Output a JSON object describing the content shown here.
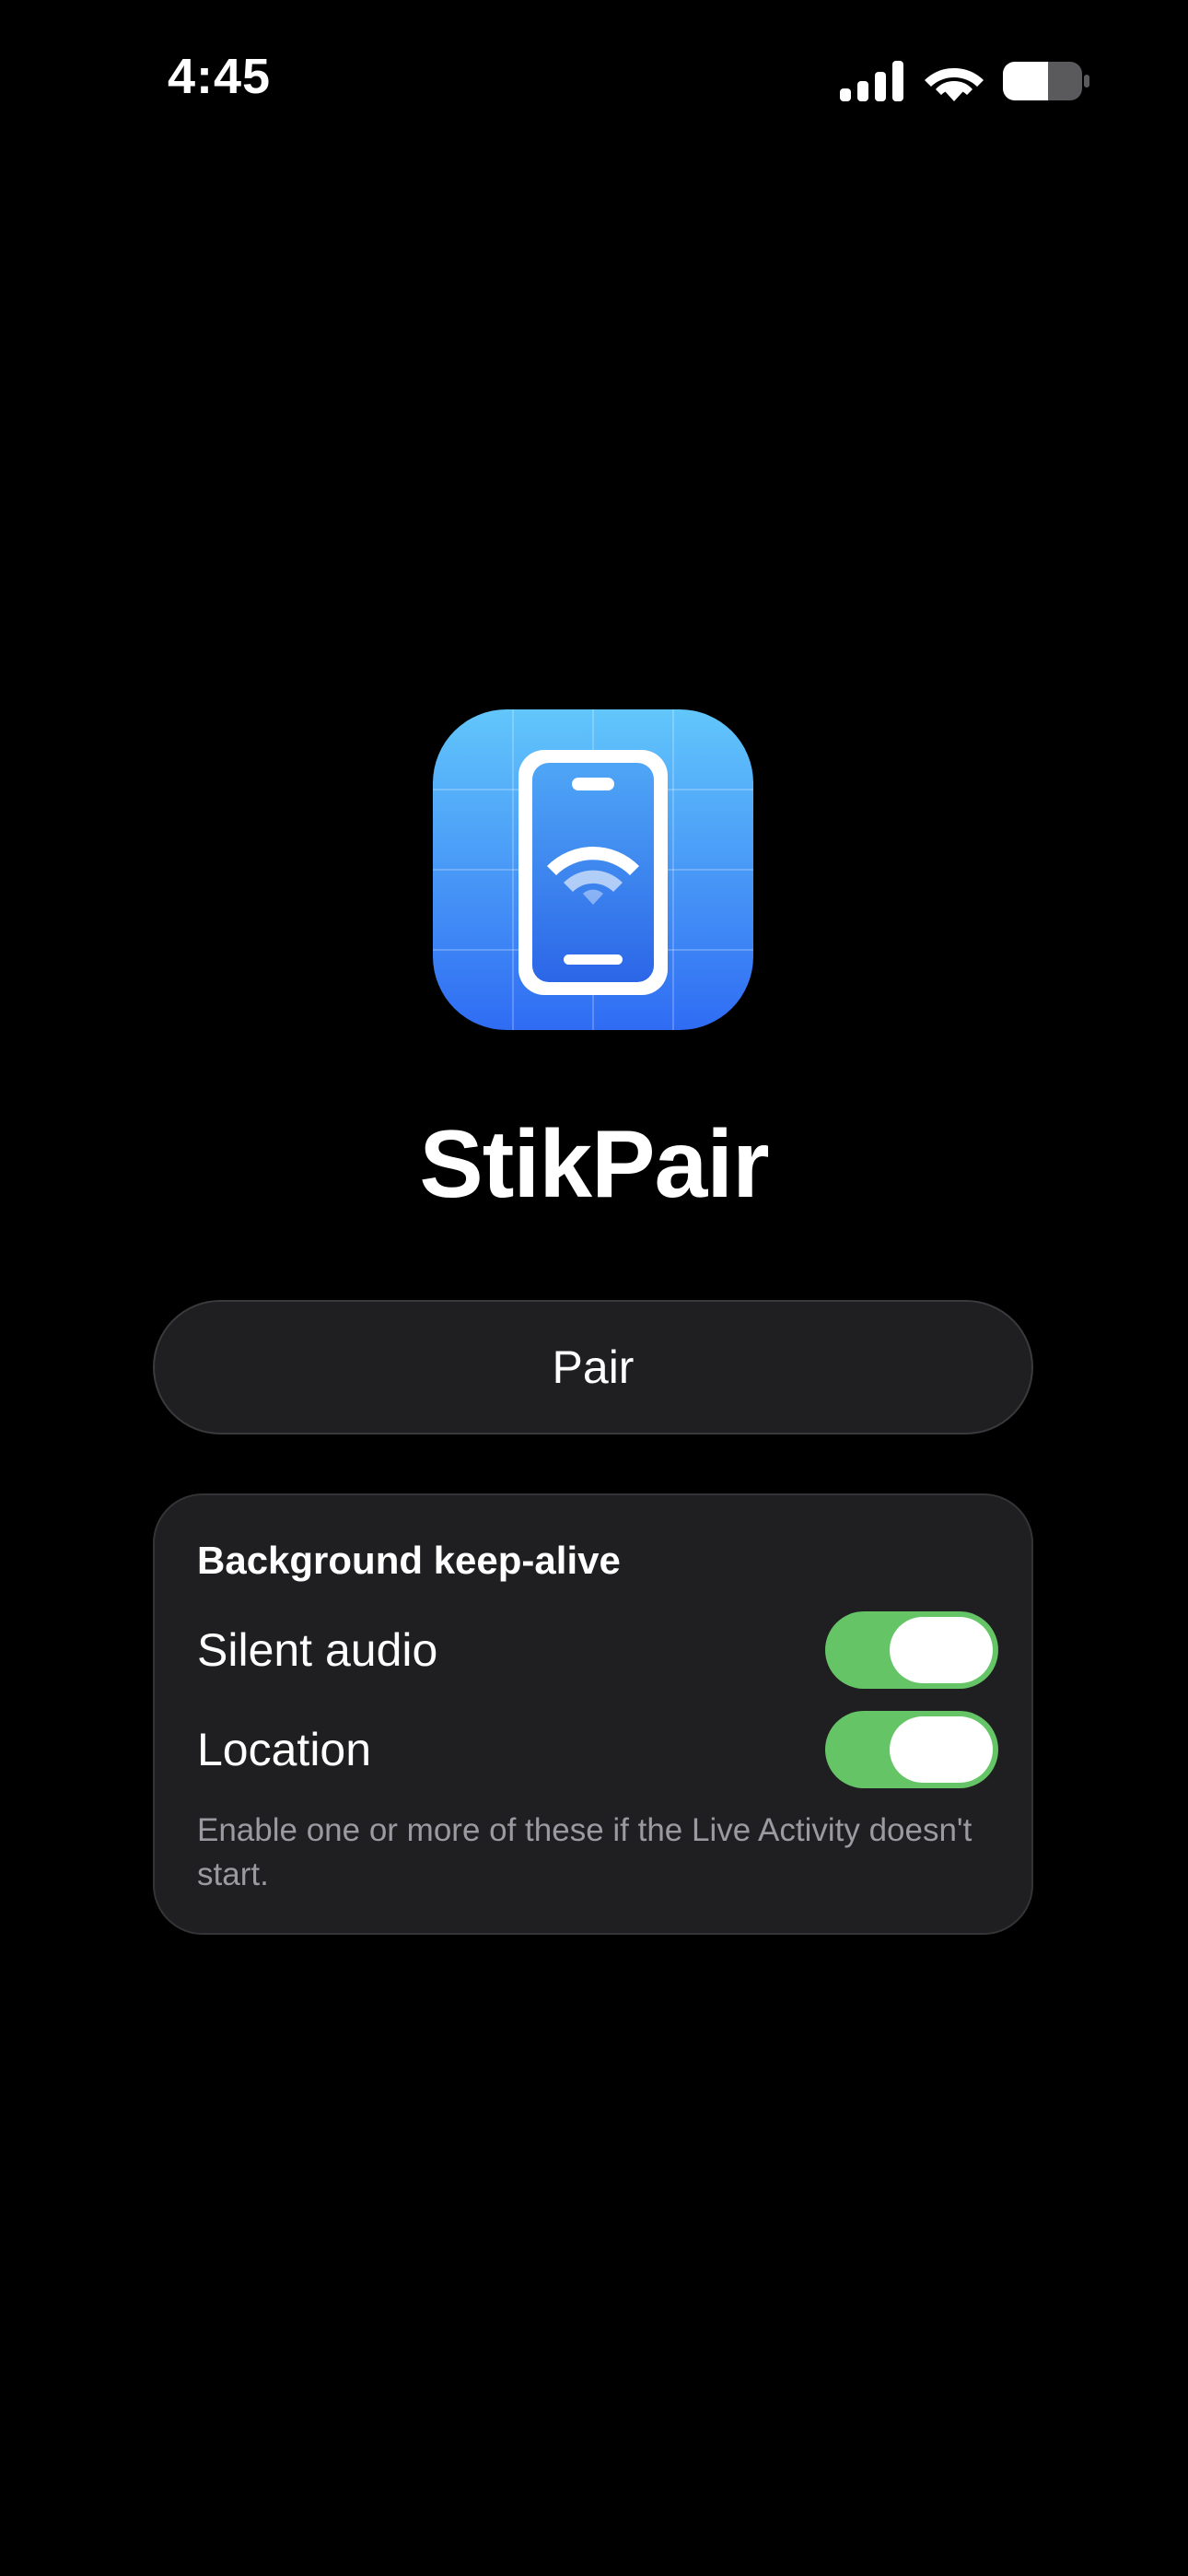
{
  "status_bar": {
    "time": "4:45",
    "icons": [
      "cellular-signal-icon",
      "wifi-icon",
      "battery-icon"
    ]
  },
  "app": {
    "icon": "phone-wifi-app-icon",
    "title": "StikPair"
  },
  "pair_button": {
    "label": "Pair"
  },
  "keep_alive": {
    "heading": "Background keep-alive",
    "options": [
      {
        "label": "Silent audio",
        "enabled": true
      },
      {
        "label": "Location",
        "enabled": true
      }
    ],
    "footnote": "Enable one or more of these if the Live Activity doesn't start."
  },
  "colors": {
    "background": "#000000",
    "card": "#1f1f21",
    "toggle_on": "#65c466",
    "icon_gradient_top": "#62c6fb",
    "icon_gradient_bottom": "#2f6cf3",
    "footnote_text": "#9a9aa0"
  }
}
